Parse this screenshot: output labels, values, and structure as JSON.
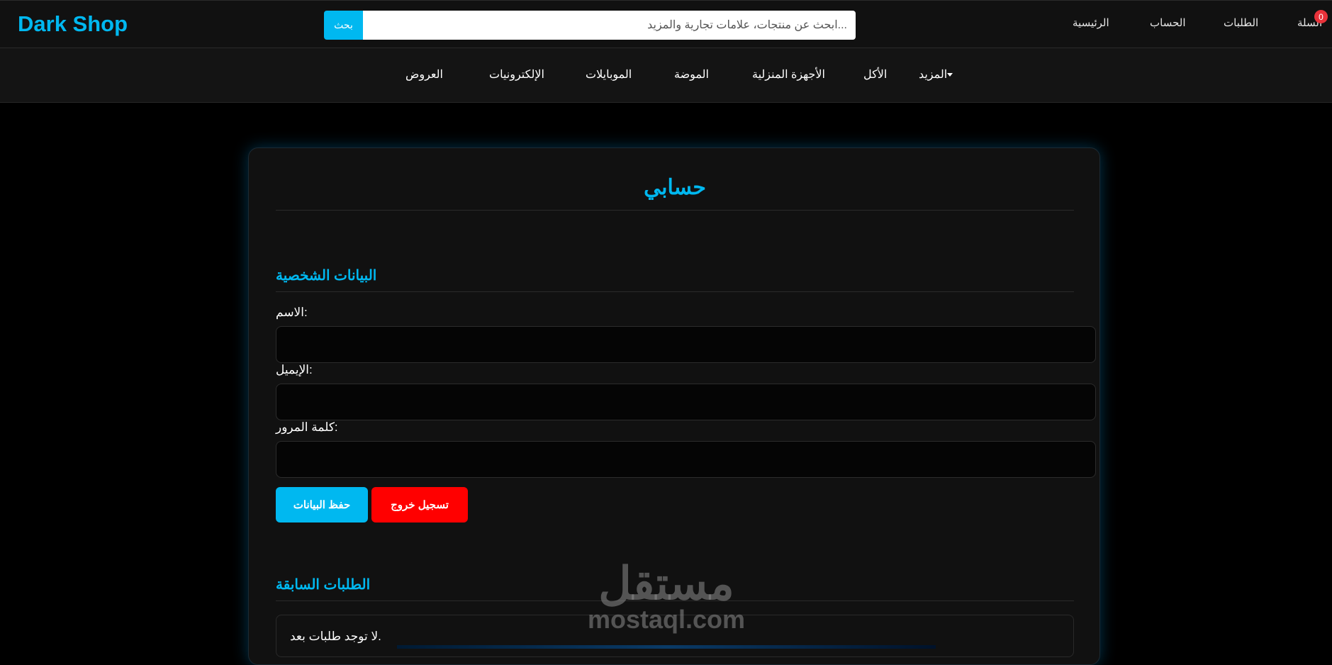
{
  "header": {
    "logo": "Dark Shop",
    "search": {
      "placeholder": "...ابحث عن منتجات، علامات تجارية والمزيد",
      "button": "بحث"
    },
    "nav": {
      "home": "الرئيسية",
      "account": "الحساب",
      "orders": "الطلبات",
      "cart": "السلة",
      "cart_count": "0"
    }
  },
  "categories": {
    "more": "المزيد",
    "food": "الأكل",
    "home_appliances": "الأجهزة المنزلية",
    "fashion": "الموضة",
    "mobiles": "الموبايلات",
    "electronics": "الإلكترونيات",
    "offers": "العروض"
  },
  "account": {
    "title": "حسابي",
    "personal_section": "البيانات الشخصية",
    "name_label": "الاسم:",
    "email_label": "الإيميل:",
    "password_label": "كلمة المرور:",
    "save_button": "حفظ البيانات",
    "logout_button": "تسجيل خروج",
    "orders_section": "الطلبات السابقة",
    "orders_empty": "لا توجد طلبات بعد."
  },
  "watermark": {
    "arabic": "مستقل",
    "latin": "mostaql.com"
  },
  "colors": {
    "accent": "#00b8f0",
    "danger": "#ff0000",
    "badge": "#e8323a",
    "background": "#000000"
  }
}
